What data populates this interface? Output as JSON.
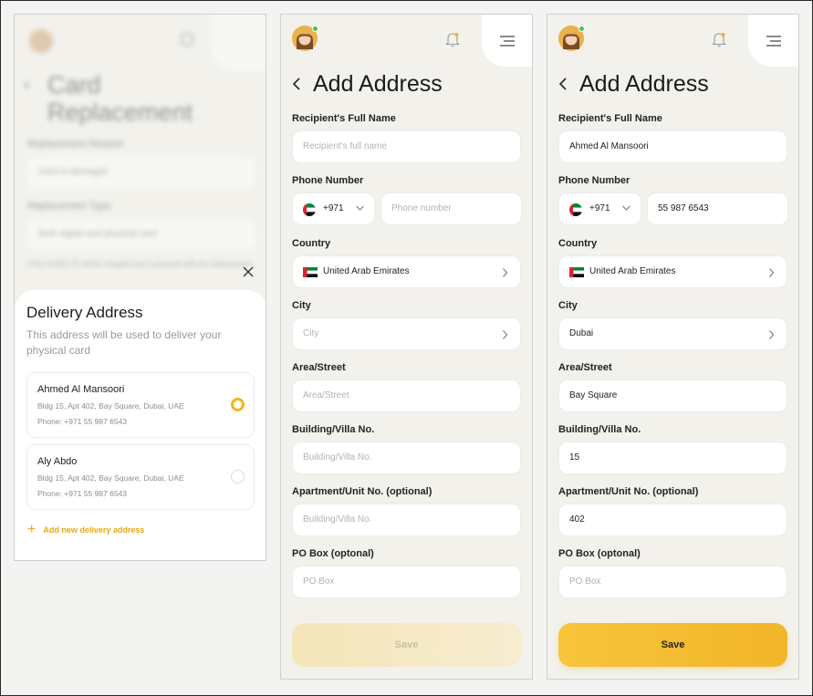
{
  "screen1": {
    "background": {
      "title": "Card Replacement",
      "reason_label": "Replacement Reason",
      "reason_value": "Card is damaged",
      "type_label": "Replacement Type",
      "type_value": "Both digital and physical card",
      "note": "A fee of AED 25 will be charged now to proceed with the replacement"
    },
    "sheet": {
      "title": "Delivery Address",
      "subtitle": "This address will be used to deliver your physical card",
      "addresses": [
        {
          "name": "Ahmed Al Mansoori",
          "line": "Bldg 15, Apt 402, Bay Square, Dubai, UAE",
          "phone": "Phone: +971 55 987 6543",
          "selected": true
        },
        {
          "name": "Aly Abdo",
          "line": "Bldg 15, Apt 402, Bay Square, Dubai, UAE",
          "phone": "Phone: +971 55 987 6543",
          "selected": false
        }
      ],
      "add_new": "Add new delivery address"
    }
  },
  "form_empty": {
    "title": "Add Address",
    "labels": {
      "full_name": "Recipient's Full Name",
      "phone": "Phone Number",
      "country": "Country",
      "city": "City",
      "area": "Area/Street",
      "building": "Building/Villa No.",
      "apartment": "Apartment/Unit No. (optional)",
      "po_box": "PO Box (optonal)"
    },
    "placeholders": {
      "full_name": "Recipient's full name",
      "phone": "Phone number",
      "city": "City",
      "area": "Area/Street",
      "building": "Building/Villa No.",
      "apartment": "Building/Villa No.",
      "po_box": "PO Box"
    },
    "country_code": "+971",
    "country": "United Arab Emirates",
    "save": "Save"
  },
  "form_filled": {
    "title": "Add Address",
    "labels": {
      "full_name": "Recipient's Full Name",
      "phone": "Phone Number",
      "country": "Country",
      "city": "City",
      "area": "Area/Street",
      "building": "Building/Villa No.",
      "apartment": "Apartment/Unit No. (optional)",
      "po_box": "PO Box (optonal)"
    },
    "values": {
      "full_name": "Ahmed Al Mansoori",
      "phone": "55 987 6543",
      "city": "Dubai",
      "area": "Bay Square",
      "building": "15",
      "apartment": "402"
    },
    "placeholders": {
      "po_box": "PO Box"
    },
    "country_code": "+971",
    "country": "United Arab Emirates",
    "save": "Save"
  },
  "colors": {
    "accent": "#f3b421",
    "background": "#f2f1ec",
    "card": "#ffffff",
    "online": "#4fbf4f"
  }
}
